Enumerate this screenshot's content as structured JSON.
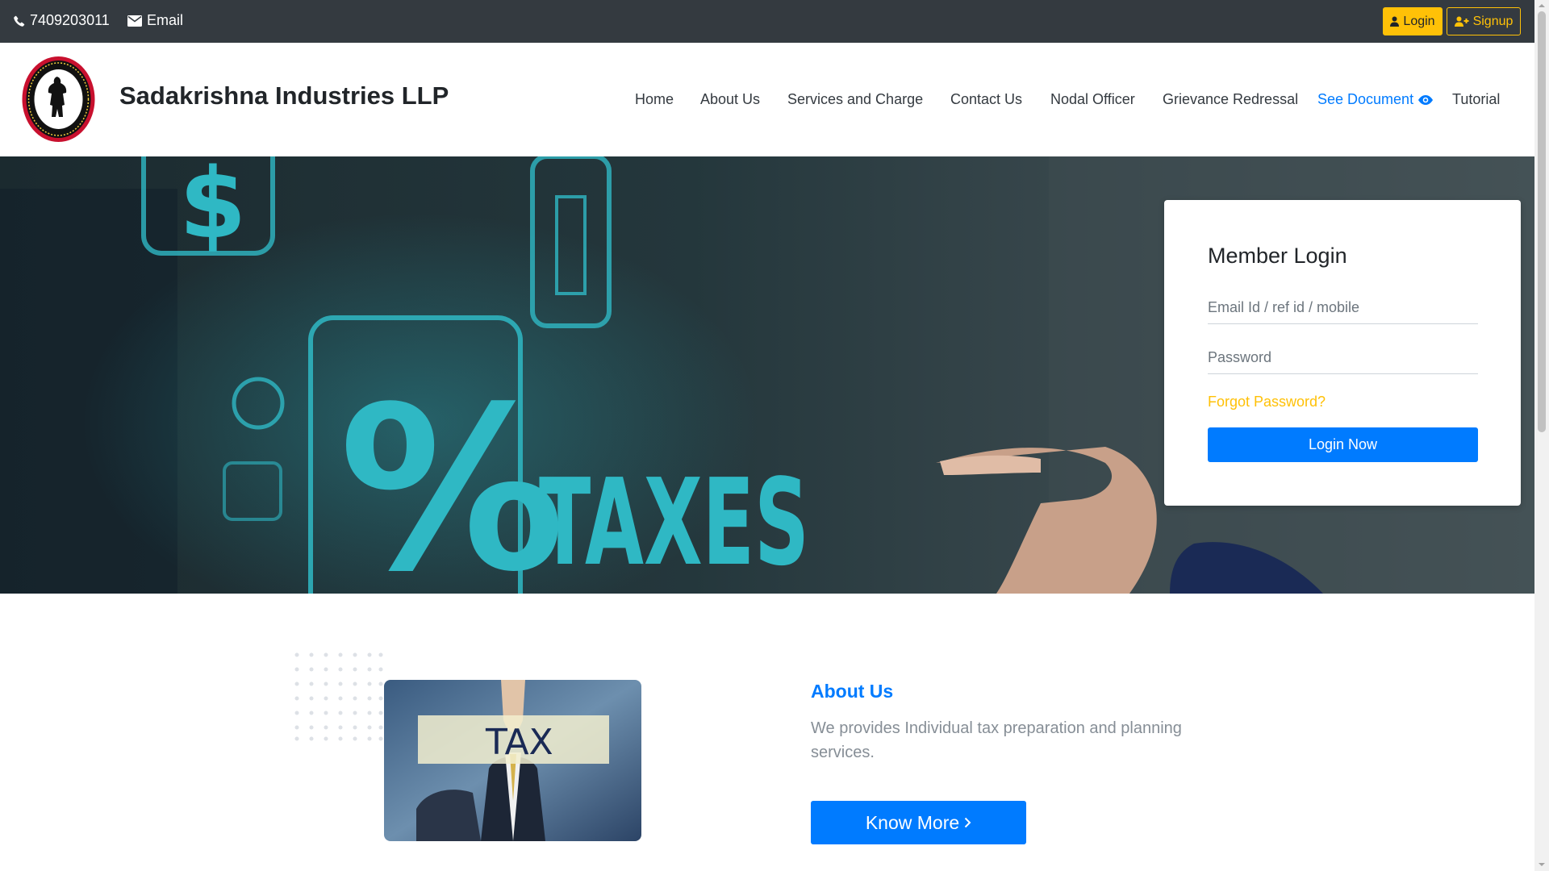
{
  "topbar": {
    "phone": "7409203011",
    "email_label": "Email",
    "login_label": "Login",
    "signup_label": "Signup"
  },
  "header": {
    "brand": "Sadakrishna Industries LLP",
    "nav": [
      {
        "label": "Home"
      },
      {
        "label": "About Us"
      },
      {
        "label": "Services and Charge"
      },
      {
        "label": "Contact Us"
      },
      {
        "label": "Nodal Officer"
      },
      {
        "label": "Grievance Redressal"
      },
      {
        "label": "See Document"
      },
      {
        "label": "Tutorial"
      }
    ]
  },
  "hero": {
    "banner_text": "TAXES",
    "percent_symbol": "%",
    "dollar_symbol": "$"
  },
  "login": {
    "title": "Member Login",
    "email_placeholder": "Email Id / ref id / mobile",
    "password_placeholder": "Password",
    "forgot": "Forgot Password?",
    "button": "Login Now"
  },
  "about": {
    "image_text": "TAX",
    "title": "About Us",
    "text": "We provides Individual tax preparation and planning services.",
    "button": "Know More"
  },
  "colors": {
    "primary": "#007bff",
    "warning": "#ffc107",
    "dark": "#343a40",
    "hero_accent": "#2fb8c4"
  },
  "icons": [
    "phone-icon",
    "envelope-icon",
    "user-icon",
    "user-plus-icon",
    "eye-icon",
    "chevron-right-icon"
  ]
}
